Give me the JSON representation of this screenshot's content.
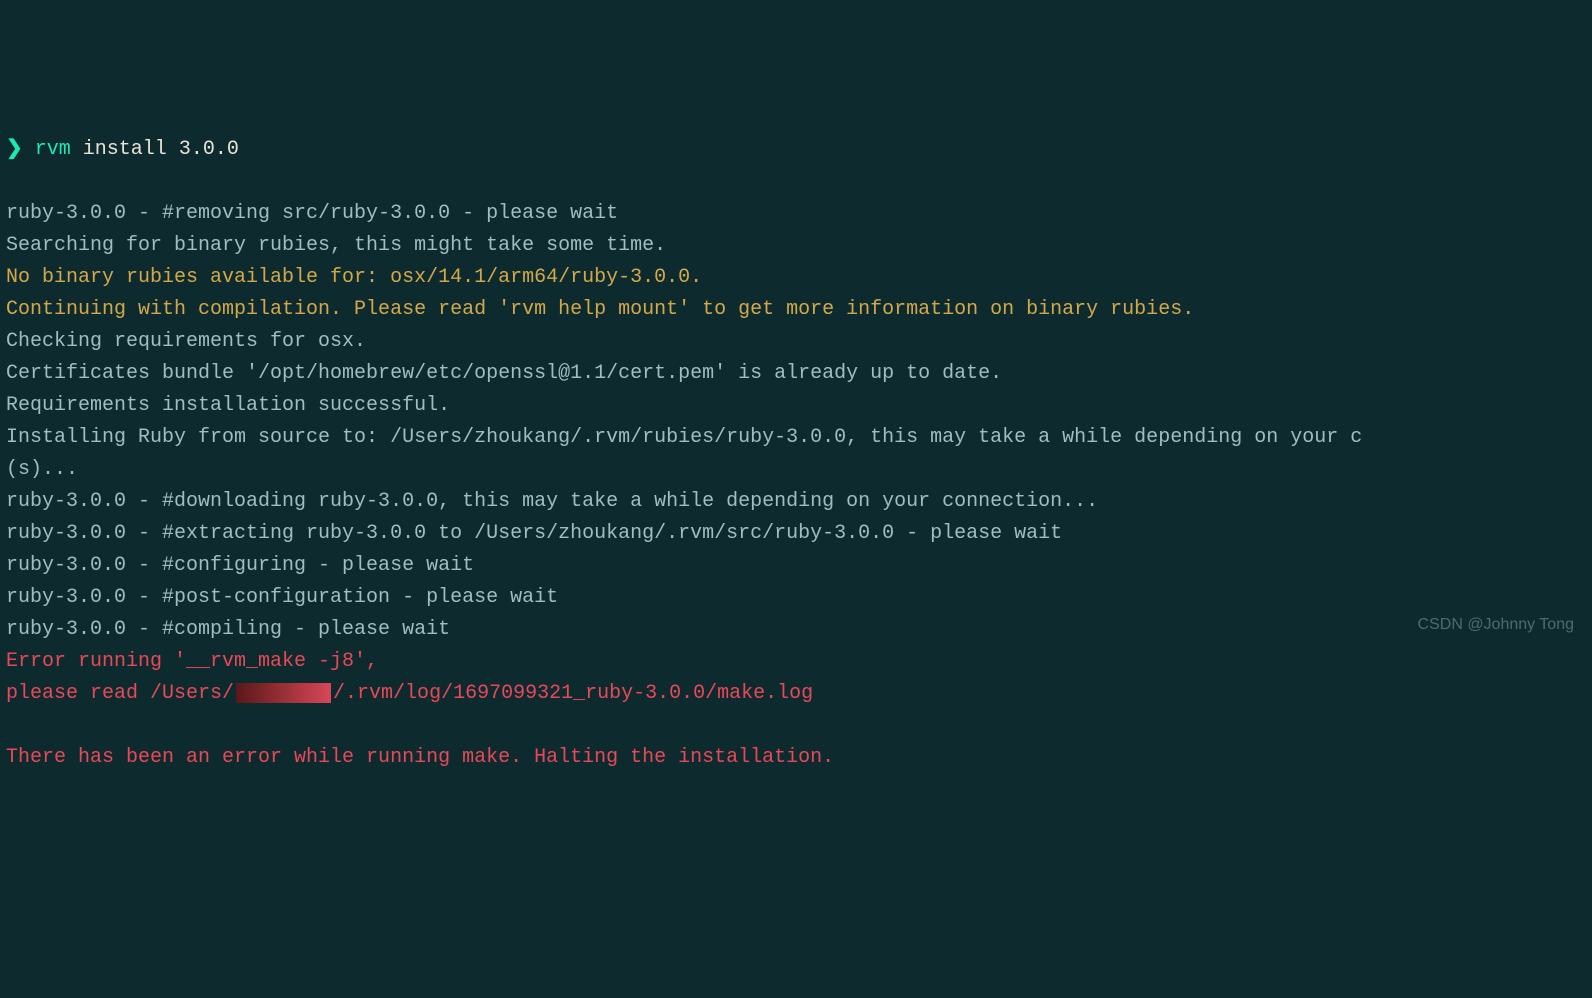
{
  "prompt": {
    "char": "❯",
    "cmd": "rvm",
    "args": " install 3.0.0"
  },
  "lines": {
    "l1": "ruby-3.0.0 - #removing src/ruby-3.0.0 - please wait",
    "l2": "Searching for binary rubies, this might take some time.",
    "l3": "No binary rubies available for: osx/14.1/arm64/ruby-3.0.0.",
    "l4": "Continuing with compilation. Please read 'rvm help mount' to get more information on binary rubies.",
    "l5": "Checking requirements for osx.",
    "l6": "Certificates bundle '/opt/homebrew/etc/openssl@1.1/cert.pem' is already up to date.",
    "l7": "Requirements installation successful.",
    "l8": "Installing Ruby from source to: /Users/zhoukang/.rvm/rubies/ruby-3.0.0, this may take a while depending on your c",
    "l9": "(s)...",
    "l10": "ruby-3.0.0 - #downloading ruby-3.0.0, this may take a while depending on your connection...",
    "l11": "ruby-3.0.0 - #extracting ruby-3.0.0 to /Users/zhoukang/.rvm/src/ruby-3.0.0 - please wait",
    "l12": "ruby-3.0.0 - #configuring - please wait",
    "l13": "ruby-3.0.0 - #post-configuration - please wait",
    "l14": "ruby-3.0.0 - #compiling - please wait",
    "l15": "Error running '__rvm_make -j8',",
    "l16a": "please read /Users/",
    "l16b": "/.rvm/log/1697099321_ruby-3.0.0/make.log",
    "l17": "",
    "l18": "There has been an error while running make. Halting the installation."
  },
  "watermark": "CSDN @Johnny Tong"
}
